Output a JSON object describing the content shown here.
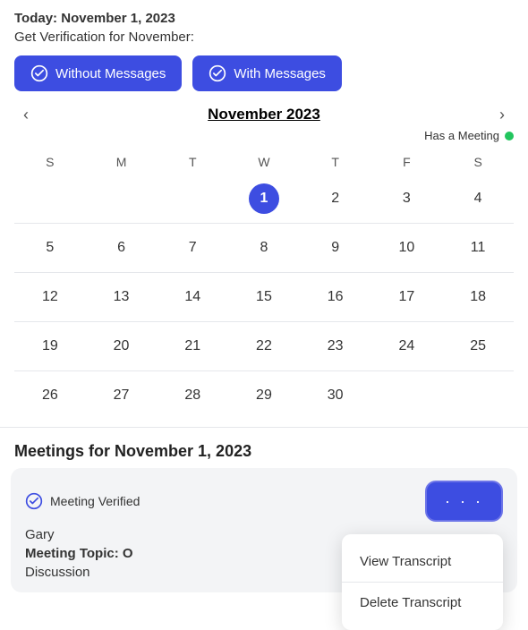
{
  "header": {
    "today_prefix": "Today: ",
    "today_date": "November 1, 2023",
    "verification_label": "Get Verification for November:"
  },
  "buttons": {
    "without_messages": "Without Messages",
    "with_messages": "With Messages"
  },
  "calendar": {
    "month_label": "November 2023",
    "has_meeting_label": "Has a Meeting",
    "days_of_week": [
      "S",
      "M",
      "T",
      "W",
      "T",
      "F",
      "S"
    ],
    "weeks": [
      [
        null,
        null,
        null,
        "1",
        "2",
        "3",
        "4"
      ],
      [
        "5",
        "6",
        "7",
        "8",
        "9",
        "10",
        "11"
      ],
      [
        "12",
        "13",
        "14",
        "15",
        "16",
        "17",
        "18"
      ],
      [
        "19",
        "20",
        "21",
        "22",
        "23",
        "24",
        "25"
      ],
      [
        "26",
        "27",
        "28",
        "29",
        "30",
        null,
        null
      ]
    ],
    "selected_day": "1"
  },
  "meetings_section": {
    "header": "Meetings for November 1, 2023"
  },
  "meeting_card": {
    "verified_label": "Meeting Verified",
    "person_name": "Gary",
    "topic_label": "Meeting Topic:",
    "topic_text": "O",
    "topic_suffix": "Discussion"
  },
  "dropdown": {
    "items": [
      "View Transcript",
      "Delete Transcript"
    ]
  },
  "three_dots": "• • •"
}
